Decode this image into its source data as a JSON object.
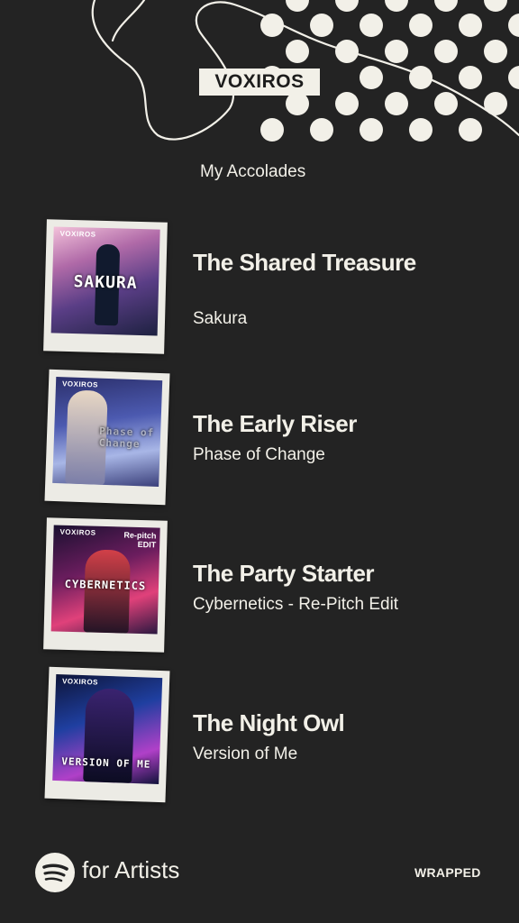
{
  "header": {
    "artist_tag": "VOXIROS",
    "section_title": "My Accolades"
  },
  "awards": [
    {
      "title": "The Shared Treasure",
      "song": "Sakura",
      "cover_label": "VOXIROS",
      "cover_title": "SAKURA"
    },
    {
      "title": "The Early Riser",
      "song": "Phase of Change",
      "cover_label": "VOXIROS",
      "cover_title": "Phase of Change"
    },
    {
      "title": "The Party Starter",
      "song": "Cybernetics - Re-Pitch Edit",
      "cover_label": "VOXIROS",
      "cover_title": "CYBERNETICS",
      "cover_extra": "Re-pitch EDIT"
    },
    {
      "title": "The Night Owl",
      "song": "Version of Me",
      "cover_label": "VOXIROS",
      "cover_title": "VERSION OF ME"
    }
  ],
  "footer": {
    "brand_suffix": "for Artists",
    "wrapped_label": "WRAPPED",
    "logo_icon": "spotify-logo-icon"
  },
  "colors": {
    "background": "#232323",
    "foreground": "#f2f0e8"
  }
}
